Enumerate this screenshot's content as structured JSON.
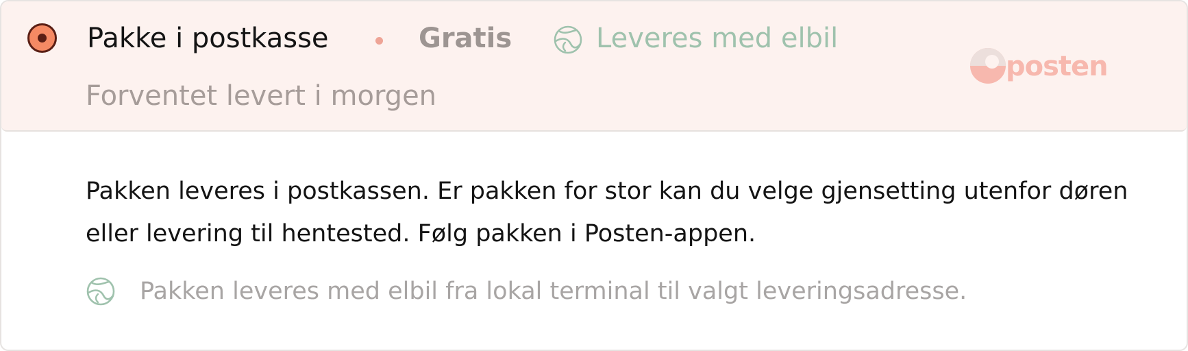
{
  "option": {
    "selected": true,
    "title": "Pakke i postkasse",
    "price": "Gratis",
    "elbil_icon": "leaf-globe-icon",
    "elbil_label": "Leveres med elbil",
    "eta": "Forventet levert i morgen",
    "brand_name": "posten",
    "brand_logo": "posten-logo"
  },
  "details": {
    "description_lines": [
      "Pakken leveres i postkassen. Er pakken for stor kan du velge gjensetting utenfor døren",
      "eller levering til hentested. Følg pakken i Posten-appen."
    ],
    "elbil_note": "Pakken leveres med elbil fra lokal terminal til valgt leveringsadresse."
  },
  "colors": {
    "header_background": "#fdf2ef",
    "radio_fill": "#f58a64",
    "radio_border": "#5a1e14",
    "elbil_green": "#9fc2ad",
    "brand_pink": "#f7b8ae"
  }
}
